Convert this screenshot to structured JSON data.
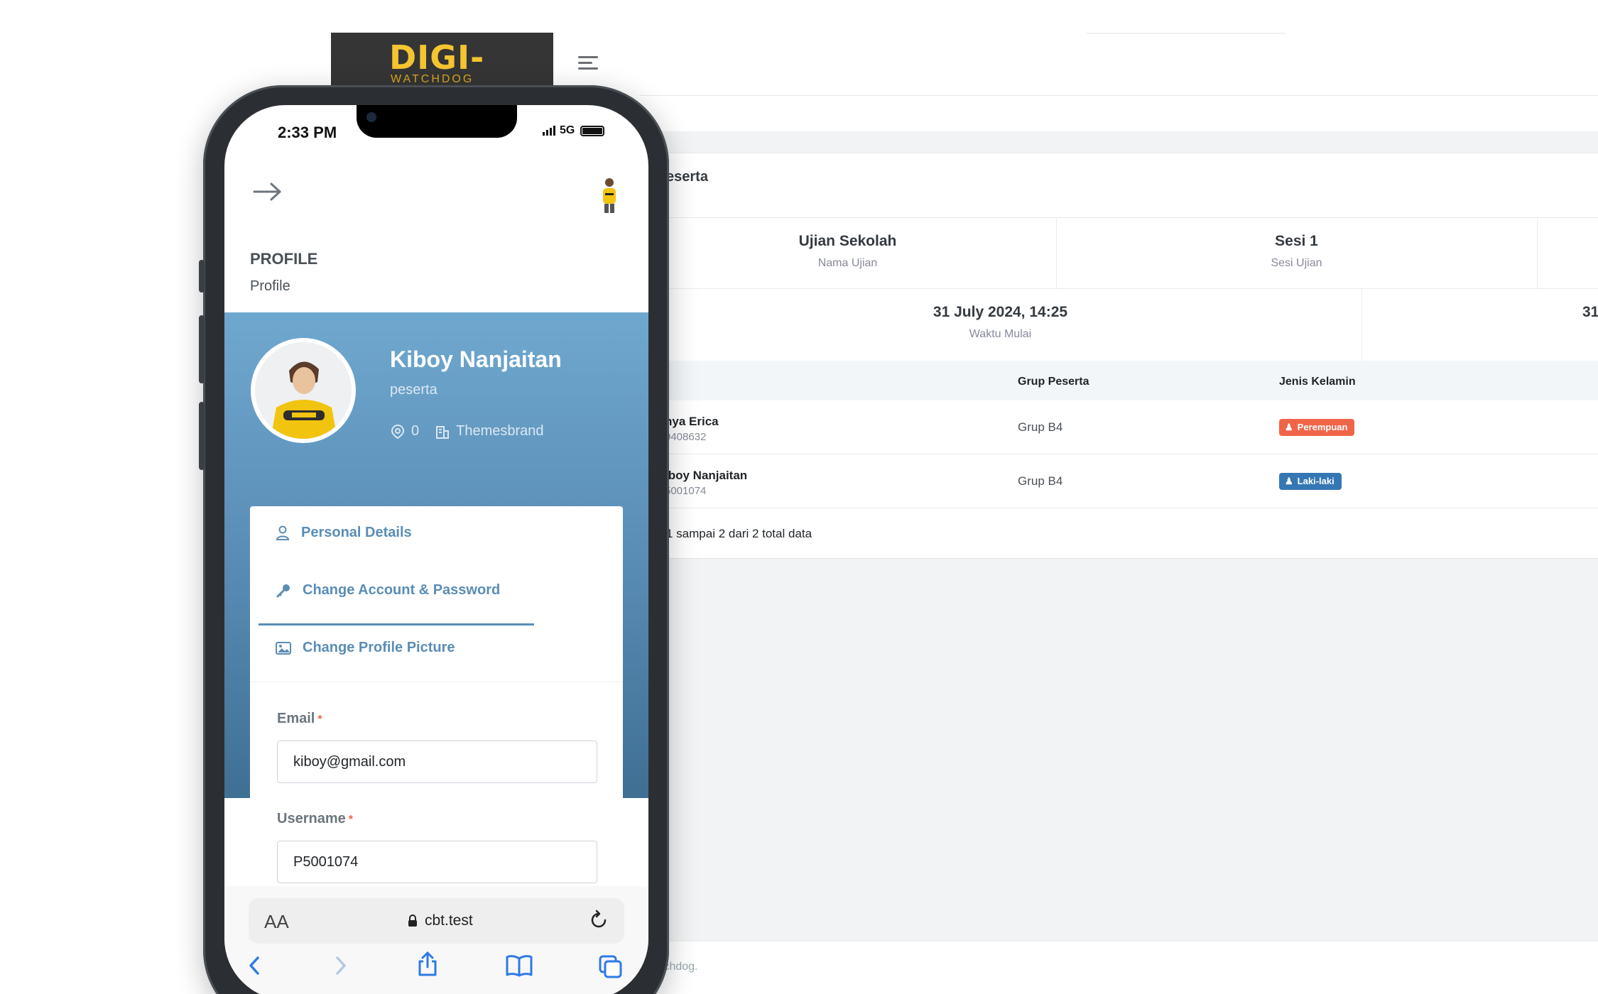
{
  "background_app": {
    "logo_main": "DIGI-",
    "logo_sub": "WATCHDOG",
    "card_title_fragment": "eserta",
    "info_top": [
      {
        "value": "Ujian Sekolah",
        "label": "Nama Ujian"
      },
      {
        "value": "Sesi 1",
        "label": "Sesi Ujian"
      }
    ],
    "info_bottom": [
      {
        "value": "31 July 2024, 14:25",
        "label": "Waktu Mulai"
      },
      {
        "value": "31",
        "label": ""
      }
    ],
    "table_headers": {
      "group": "Grup Peserta",
      "gender": "Jenis Kelamin"
    },
    "rows": [
      {
        "name": "nya Erica",
        "id": "9408632",
        "group": "Grup B4",
        "gender": "Perempuan"
      },
      {
        "name": "iboy Nanjaitan",
        "id": "5001074",
        "group": "Grup B4",
        "gender": "Laki-laki"
      }
    ],
    "table_footer": "1 sampai 2 dari 2 total data",
    "footer_fragment": "tchdog."
  },
  "phone": {
    "status": {
      "time": "2:33 PM",
      "network": "5G"
    },
    "page_title": "PROFILE",
    "page_subtitle": "Profile",
    "profile": {
      "name": "Kiboy Nanjaitan",
      "role": "peserta",
      "location_count": "0",
      "company": "Themesbrand"
    },
    "menu": [
      {
        "label": "Personal Details",
        "icon": "user-icon"
      },
      {
        "label": "Change Account & Password",
        "icon": "key-icon"
      },
      {
        "label": "Change Profile Picture",
        "icon": "image-icon"
      }
    ],
    "form": {
      "email_label": "Email",
      "email_value": "kiboy@gmail.com",
      "username_label": "Username",
      "username_value": "P5001074",
      "required_mark": "*"
    },
    "browser": {
      "text_size": "AA",
      "url": "cbt.test"
    }
  },
  "colors": {
    "accent": "#5a8db6",
    "badge_female": "#f06548",
    "badge_male": "#3577b4",
    "logo_yellow": "#f4c530"
  }
}
